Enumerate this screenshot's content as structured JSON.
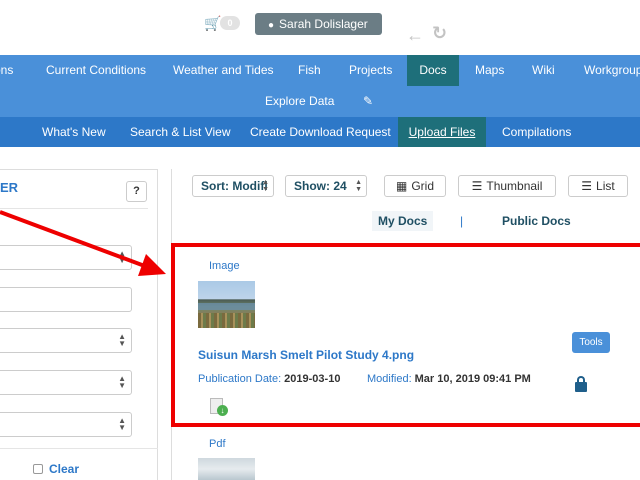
{
  "header": {
    "cart_count": "0",
    "user_name": "Sarah Dolislager",
    "icons": {
      "cart": "cart-icon",
      "user": "user-icon",
      "back": "back-arrow-icon",
      "reload": "reload-icon"
    }
  },
  "main_nav": {
    "items": [
      {
        "label": "ons"
      },
      {
        "label": "Current Conditions"
      },
      {
        "label": "Weather and Tides"
      },
      {
        "label": "Fish"
      },
      {
        "label": "Projects"
      },
      {
        "label": "Docs"
      },
      {
        "label": "Maps"
      },
      {
        "label": "Wiki"
      },
      {
        "label": "Workgroup"
      }
    ],
    "active": "Docs",
    "explore_label": "Explore Data"
  },
  "sub_nav": {
    "items": [
      {
        "label": "What's New"
      },
      {
        "label": "Search & List View"
      },
      {
        "label": "Create Download Request"
      },
      {
        "label": "Upload Files"
      },
      {
        "label": "Compilations"
      }
    ],
    "active": "Upload Files"
  },
  "filter_panel": {
    "title": "ER",
    "help_label": "?",
    "clear_label": "Clear"
  },
  "toolbar": {
    "sort_value": "Sort: Modifi",
    "show_value": "Show: 24",
    "grid_label": "Grid",
    "thumbnail_label": "Thumbnail",
    "list_label": "List"
  },
  "doc_tabs": {
    "my_docs": "My Docs",
    "separator": "|",
    "public_docs": "Public Docs"
  },
  "document": {
    "type": "Image",
    "title": "Suisun Marsh Smelt Pilot Study 4.png",
    "publication_label": "Publication Date:",
    "publication_date": "2019-03-10",
    "modified_label": "Modified:",
    "modified_date": "Mar 10, 2019 09:41 PM",
    "tools_label": "Tools"
  },
  "next_document": {
    "type": "Pdf"
  },
  "annotation": {
    "color": "#ee0000"
  },
  "colors": {
    "nav_bg": "#4a90d9",
    "subnav_bg": "#2d78c8",
    "active_tab_bg": "#1e6f7a",
    "link_blue": "#2d78c8",
    "user_button_bg": "#6b7d85"
  }
}
